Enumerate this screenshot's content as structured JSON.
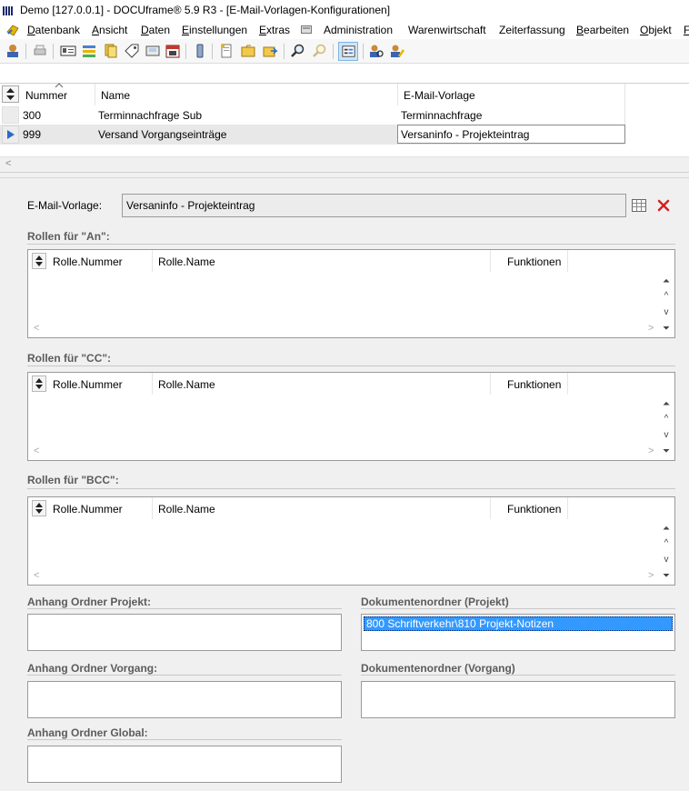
{
  "window": {
    "title": "Demo [127.0.0.1] - DOCUframe® 5.9 R3 - [E-Mail-Vorlagen-Konfigurationen]"
  },
  "menu": {
    "items": [
      "Datenbank",
      "Ansicht",
      "Daten",
      "Einstellungen",
      "Extras",
      "Administration",
      "Warenwirtschaft",
      "Zeiterfassung",
      "Bearbeiten",
      "Objekt",
      "F"
    ],
    "underline": [
      "D",
      "A",
      "D",
      "E",
      "E",
      "",
      "",
      "",
      "B",
      "O",
      "F"
    ]
  },
  "grid": {
    "columns": [
      "Nummer",
      "Name",
      "E-Mail-Vorlage"
    ],
    "rows": [
      {
        "nummer": "300",
        "name": "Terminnachfrage Sub",
        "vorlage": "Terminnachfrage"
      },
      {
        "nummer": "999",
        "name": "Versand Vorgangseinträge",
        "vorlage": "Versaninfo - Projekteintrag"
      }
    ],
    "selected_row": 1
  },
  "form": {
    "email_label": "E-Mail-Vorlage:",
    "email_value": "Versaninfo - Projekteintrag",
    "rollen_an": "Rollen für \"An\":",
    "rollen_cc": "Rollen für \"CC\":",
    "rollen_bcc": "Rollen für \"BCC\":",
    "col_nummer": "Rolle.Nummer",
    "col_name": "Rolle.Name",
    "col_funktionen": "Funktionen",
    "anhang_projekt": "Anhang Ordner Projekt:",
    "anhang_vorgang": "Anhang Ordner Vorgang:",
    "anhang_global": "Anhang Ordner Global:",
    "dok_projekt": "Dokumentenordner (Projekt)",
    "dok_vorgang": "Dokumentenordner (Vorgang)",
    "dok_projekt_item": "800 Schriftverkehr\\810 Projekt-Notizen"
  },
  "colors": {
    "selection": "#3399ff",
    "delete_red": "#d42020"
  }
}
